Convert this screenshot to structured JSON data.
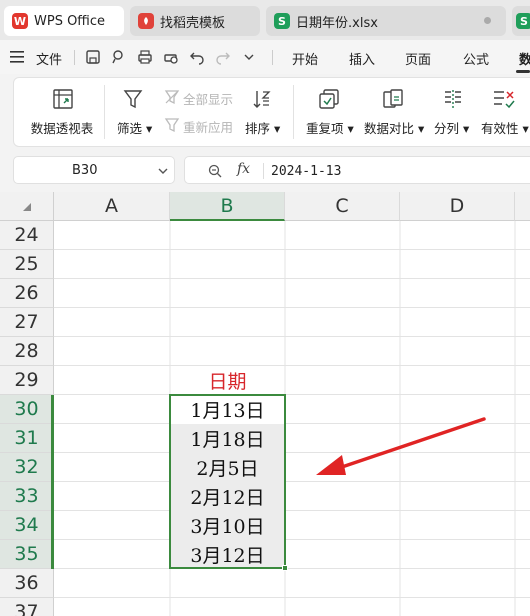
{
  "tabs": [
    {
      "label": "WPS Office",
      "icon": "wps-logo-icon",
      "icon_text": "W",
      "color": "#e2372e"
    },
    {
      "label": "找稻壳模板",
      "icon": "docer-icon",
      "icon_text": "",
      "color": "#e0423a"
    },
    {
      "label": "日期年份.xlsx",
      "icon": "spreadsheet-icon",
      "icon_text": "S",
      "color": "#1f9e5a"
    }
  ],
  "menu": {
    "file": "文件",
    "tabs": [
      "开始",
      "插入",
      "页面",
      "公式",
      "数"
    ]
  },
  "ribbon": {
    "pivot": "数据透视表",
    "filter": "筛选",
    "show_all": "全部显示",
    "reapply": "重新应用",
    "sort": "排序",
    "duplicates": "重复项",
    "compare": "数据对比",
    "split": "分列",
    "validity": "有效性"
  },
  "formula_bar": {
    "cell_ref": "B30",
    "fx": "fx",
    "value": "2024-1-13"
  },
  "sheet": {
    "columns": [
      "A",
      "B",
      "C",
      "D"
    ],
    "rows": [
      "24",
      "25",
      "26",
      "27",
      "28",
      "29",
      "30",
      "31",
      "32",
      "33",
      "34",
      "35",
      "36",
      "37"
    ],
    "header_cell": "日期",
    "dates": [
      "1月13日",
      "1月18日",
      "2月5日",
      "2月12日",
      "3月10日",
      "3月12日"
    ],
    "selected_column": "B",
    "selected_rows": [
      "30",
      "31",
      "32",
      "33",
      "34",
      "35"
    ]
  },
  "colors": {
    "accent_green": "#1f7a4d",
    "selection_border": "#3b8a3e",
    "header_text_red": "#d7262b",
    "arrow_red": "#e02424"
  }
}
